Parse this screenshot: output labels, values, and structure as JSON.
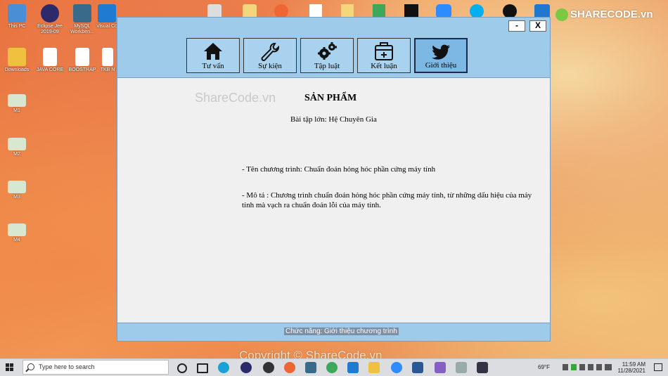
{
  "desktop": {
    "icons_left": [
      {
        "label": "This PC",
        "color": "#4a8fd6"
      },
      {
        "label": "Downloads",
        "color": "#f0c040"
      },
      {
        "label": "M1",
        "color": "#d8e8d0"
      },
      {
        "label": "M2",
        "color": "#d8e8d0"
      },
      {
        "label": "M3",
        "color": "#d8e8d0"
      },
      {
        "label": "M4",
        "color": "#d8e8d0"
      }
    ],
    "icons_top": [
      {
        "label": "Eclipse Jee 2019-09",
        "color": "#2c2a6a"
      },
      {
        "label": "MySQL Workben...",
        "color": "#3a6a8a"
      },
      {
        "label": "Visual Co",
        "color": "#1e7bd0"
      },
      {
        "label": "JAVA CORE",
        "color": "#ffffff"
      },
      {
        "label": "BOOSTRAP",
        "color": "#ffffff"
      },
      {
        "label": "TKB N",
        "color": "#ffffff"
      }
    ],
    "watermark_logo": "SHARECODE.vn",
    "watermark_bottom": "Copyright © ShareCode.vn"
  },
  "window": {
    "minimize_label": "-",
    "close_label": "X",
    "toolbar": {
      "buttons": [
        {
          "label": "Tư vấn",
          "icon": "home-icon"
        },
        {
          "label": "Sự kiện",
          "icon": "wrench-icon"
        },
        {
          "label": "Tập luật",
          "icon": "gears-icon"
        },
        {
          "label": "Kết luận",
          "icon": "medical-kit-icon"
        },
        {
          "label": "Giới thiệu",
          "icon": "twitter-bird-icon",
          "active": true
        }
      ]
    },
    "content": {
      "watermark": "ShareCode.vn",
      "title": "SẢN PHẨM",
      "subtitle": "Bài tập lớn: Hệ Chuyên Gia",
      "program_name": "- Tên chương trình: Chuẩn đoán hỏng hóc phần cứng máy tính",
      "description": "- Mô tả : Chương trình chuẩn đoán hỏng hóc phần cứng máy tính, từ những dấu hiệu của máy tính mà vạch ra chuẩn đoán lỗi của máy tính."
    },
    "status": "Chức năng: Giới thiệu chương trình"
  },
  "taskbar": {
    "search_placeholder": "Type here to search",
    "weather": "69°F",
    "time": "11:59 AM",
    "date": "11/28/2021"
  },
  "colors": {
    "titlebar": "#9fcbea",
    "active_button": "#7db8e4",
    "status_highlight": "#7c8fa6"
  }
}
